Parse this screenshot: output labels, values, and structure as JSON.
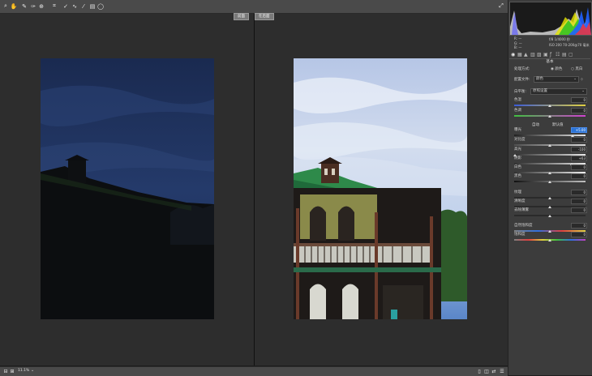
{
  "view": {
    "before_label": "前面",
    "after_label": "在后面"
  },
  "bottom": {
    "zoom": "11.1%"
  },
  "histogram": {
    "readout": [
      {
        "l": "R:",
        "v": "—"
      },
      {
        "l": "G:",
        "v": "—"
      },
      {
        "l": "B:",
        "v": "—"
      }
    ],
    "exif_line1": "f/8   1/4000 秒",
    "exif_line2": "ISO 200   70-200@70 毫米"
  },
  "basic": {
    "title": "基本",
    "treatment_label": "处理方式:",
    "treatment_color": "颜色",
    "treatment_bw": "黑白",
    "profile_label": "配置文件:",
    "profile_value": "颜色",
    "wb_label": "白平衡:",
    "wb_value": "原照设置",
    "temp_label": "色温",
    "temp_value": "0",
    "tint_label": "色调",
    "tint_value": "0",
    "auto_label": "自动",
    "default_label": "默认值",
    "exposure_label": "曝光",
    "exposure_value": "+5.00",
    "contrast_label": "对比度",
    "contrast_value": "0",
    "highlights_label": "高光",
    "highlights_value": "-100",
    "shadows_label": "阴影",
    "shadows_value": "+63",
    "whites_label": "白色",
    "whites_value": "0",
    "blacks_label": "黑色",
    "blacks_value": "0",
    "texture_label": "纹理",
    "texture_value": "0",
    "clarity_label": "清晰度",
    "clarity_value": "0",
    "dehaze_label": "去除薄雾",
    "dehaze_value": "0",
    "vibrance_label": "自然饱和度",
    "vibrance_value": "0",
    "saturation_label": "饱和度",
    "saturation_value": "0"
  },
  "colors": {
    "panel_bg": "#3c3c3c",
    "toolbar_bg": "#4a4a4a",
    "view_bg": "#2d2d2d",
    "accent": "#2b74d6"
  }
}
